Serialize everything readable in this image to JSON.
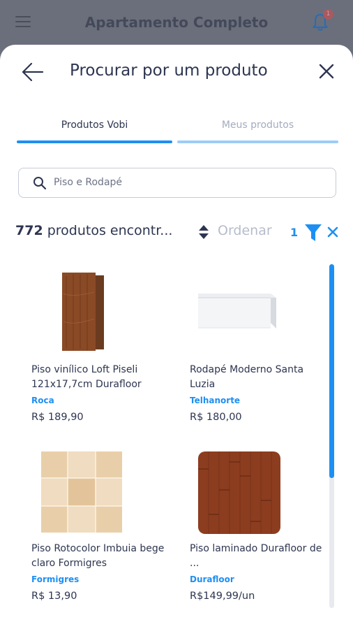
{
  "app": {
    "title": "Apartamento Completo",
    "notification_count": "1"
  },
  "sheet": {
    "title": "Procurar por um produto"
  },
  "tabs": [
    {
      "label": "Produtos Vobi",
      "active": true
    },
    {
      "label": "Meus produtos",
      "active": false
    }
  ],
  "search": {
    "value": "Piso e Rodapé",
    "placeholder": "Piso e Rodapé"
  },
  "results": {
    "count": "772",
    "label": "produtos encontr..."
  },
  "sort": {
    "label": "Ordenar"
  },
  "filter": {
    "count": "1"
  },
  "products": [
    {
      "name": "Piso vinílico Loft Piseli 121x17,7cm Durafloor",
      "store": "Roca",
      "price": "R$ 189,90",
      "image": "wood-planks"
    },
    {
      "name": "Rodapé Moderno Santa Luzia",
      "store": "Telhanorte",
      "price": "R$ 180,00",
      "image": "baseboard"
    },
    {
      "name": "Piso Rotocolor Imbuia bege claro Formigres",
      "store": "Formigres",
      "price": "R$ 13,90",
      "image": "beige-tile"
    },
    {
      "name": "Piso laminado Durafloor de ...",
      "store": "Durafloor",
      "price": "R$149,99/un",
      "image": "laminate-floor"
    }
  ],
  "colors": {
    "accent": "#1e8ff2",
    "text": "#2d3550",
    "muted": "#a4abc0",
    "overlay": "#6b6f7c"
  }
}
